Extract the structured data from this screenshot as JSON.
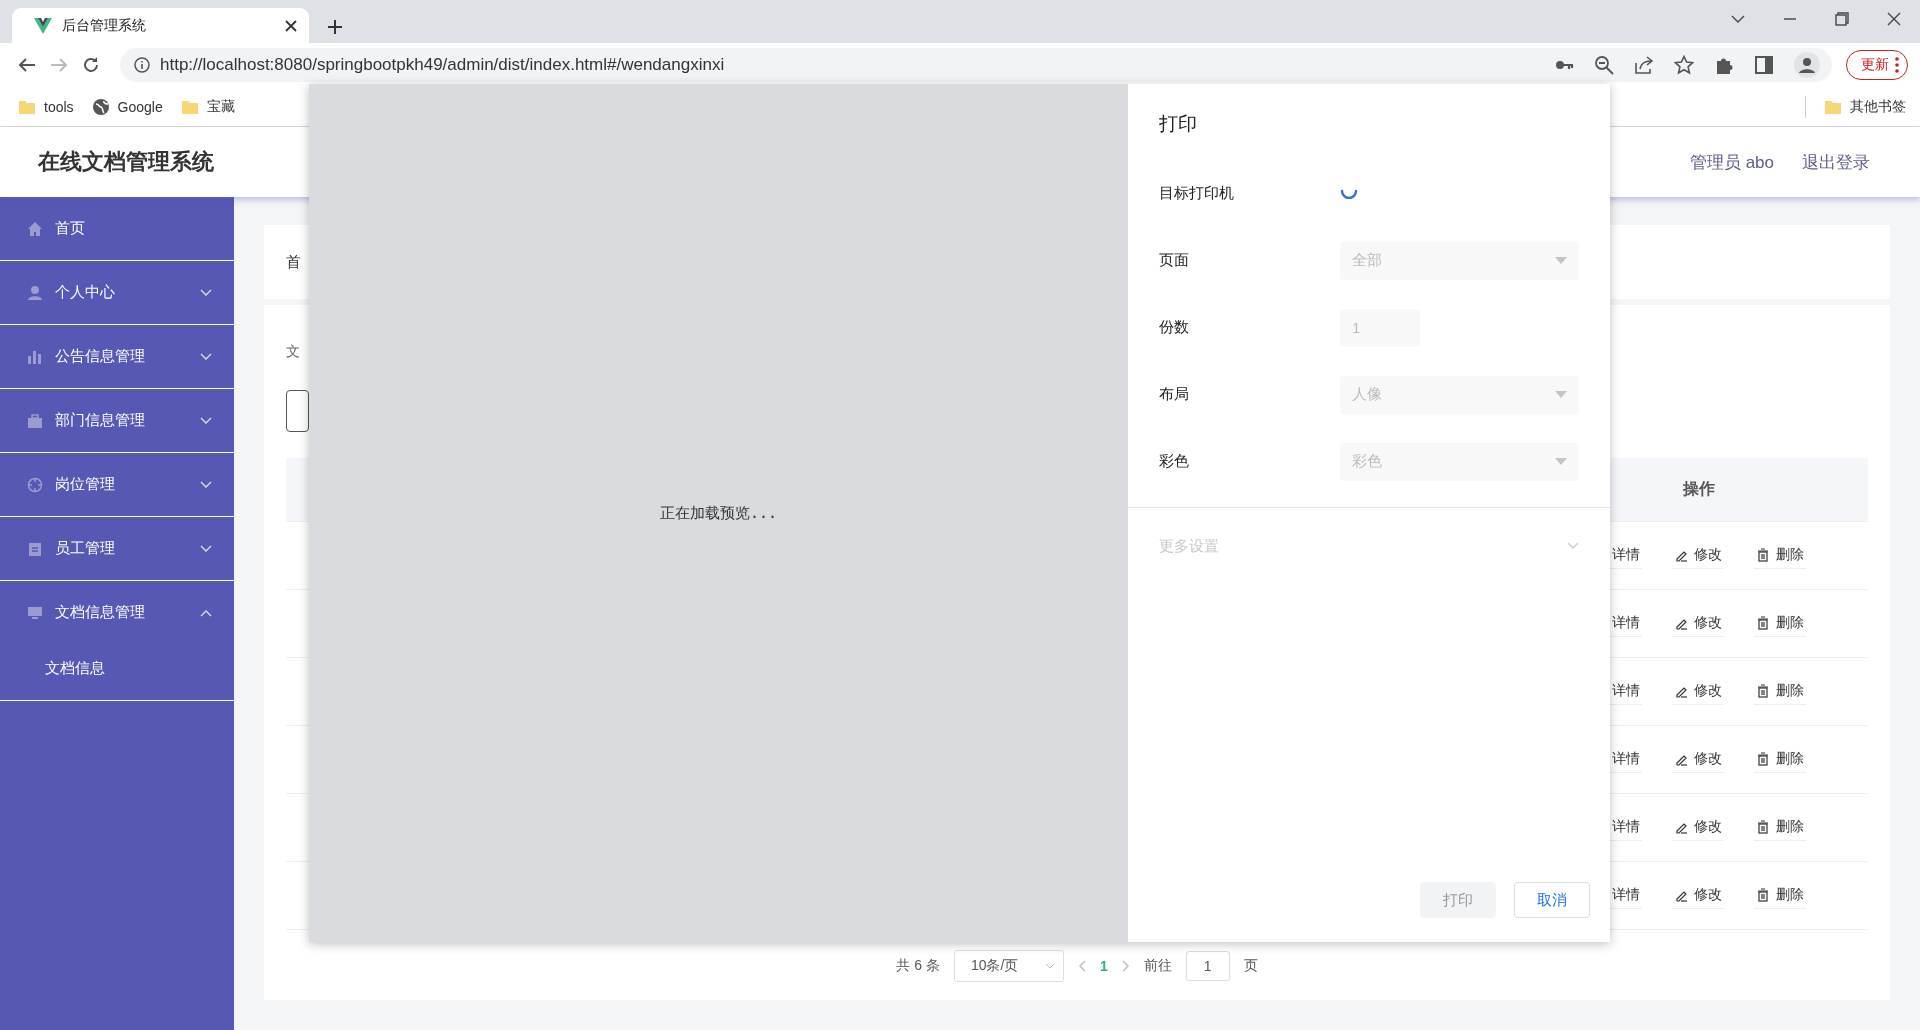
{
  "browser": {
    "tab_title": "后台管理系统",
    "url": "http://localhost:8080/springbootpkh49/admin/dist/index.html#/wendangxinxi",
    "update_button": "更新",
    "bookmarks": [
      {
        "label": "tools",
        "kind": "folder"
      },
      {
        "label": "Google",
        "kind": "site"
      },
      {
        "label": "宝藏",
        "kind": "folder"
      }
    ],
    "other_bookmarks": "其他书签"
  },
  "app": {
    "title": "在线文档管理系统",
    "user": "管理员 abo",
    "logout": "退出登录"
  },
  "sidebar": {
    "items": [
      {
        "label": "首页",
        "kind": "link"
      },
      {
        "label": "个人中心",
        "kind": "submenu",
        "expanded": false
      },
      {
        "label": "公告信息管理",
        "kind": "submenu",
        "expanded": false
      },
      {
        "label": "部门信息管理",
        "kind": "submenu",
        "expanded": false
      },
      {
        "label": "岗位管理",
        "kind": "submenu",
        "expanded": false
      },
      {
        "label": "员工管理",
        "kind": "submenu",
        "expanded": false
      },
      {
        "label": "文档信息管理",
        "kind": "submenu",
        "expanded": true,
        "children": [
          {
            "label": "文档信息"
          }
        ]
      }
    ]
  },
  "main": {
    "breadcrumb": "首",
    "section_label": "文",
    "table": {
      "columns": [
        {
          "label": "操作"
        }
      ],
      "rows": [
        {
          "actions": [
            "详情",
            "修改",
            "删除"
          ]
        },
        {
          "actions": [
            "详情",
            "修改",
            "删除"
          ]
        },
        {
          "actions": [
            "详情",
            "修改",
            "删除"
          ]
        },
        {
          "actions": [
            "详情",
            "修改",
            "删除"
          ]
        },
        {
          "actions": [
            "详情",
            "修改",
            "删除"
          ]
        },
        {
          "actions": [
            "详情",
            "修改",
            "删除"
          ]
        }
      ]
    },
    "pagination": {
      "total": "共 6 条",
      "page_size": "10条/页",
      "pages": [
        {
          "label": "1",
          "selected": true
        }
      ],
      "jump_label": "前往",
      "jump_value": "1",
      "page_unit": "页"
    }
  },
  "print_dialog": {
    "preview_status": "正在加载预览...",
    "title": "打印",
    "fields": [
      {
        "label": "目标打印机",
        "kind": "loading"
      },
      {
        "label": "页面",
        "kind": "select",
        "value": "全部",
        "disabled": true
      },
      {
        "label": "份数",
        "kind": "input",
        "value": "1",
        "disabled": true
      },
      {
        "label": "布局",
        "kind": "select",
        "value": "人像",
        "disabled": true
      },
      {
        "label": "彩色",
        "kind": "select",
        "value": "彩色",
        "disabled": true
      }
    ],
    "more_settings": {
      "label": "更多设置",
      "disabled": true
    },
    "buttons": [
      {
        "label": "打印",
        "kind": "primary",
        "disabled": true
      },
      {
        "label": "取消",
        "kind": "secondary",
        "disabled": false
      }
    ]
  }
}
